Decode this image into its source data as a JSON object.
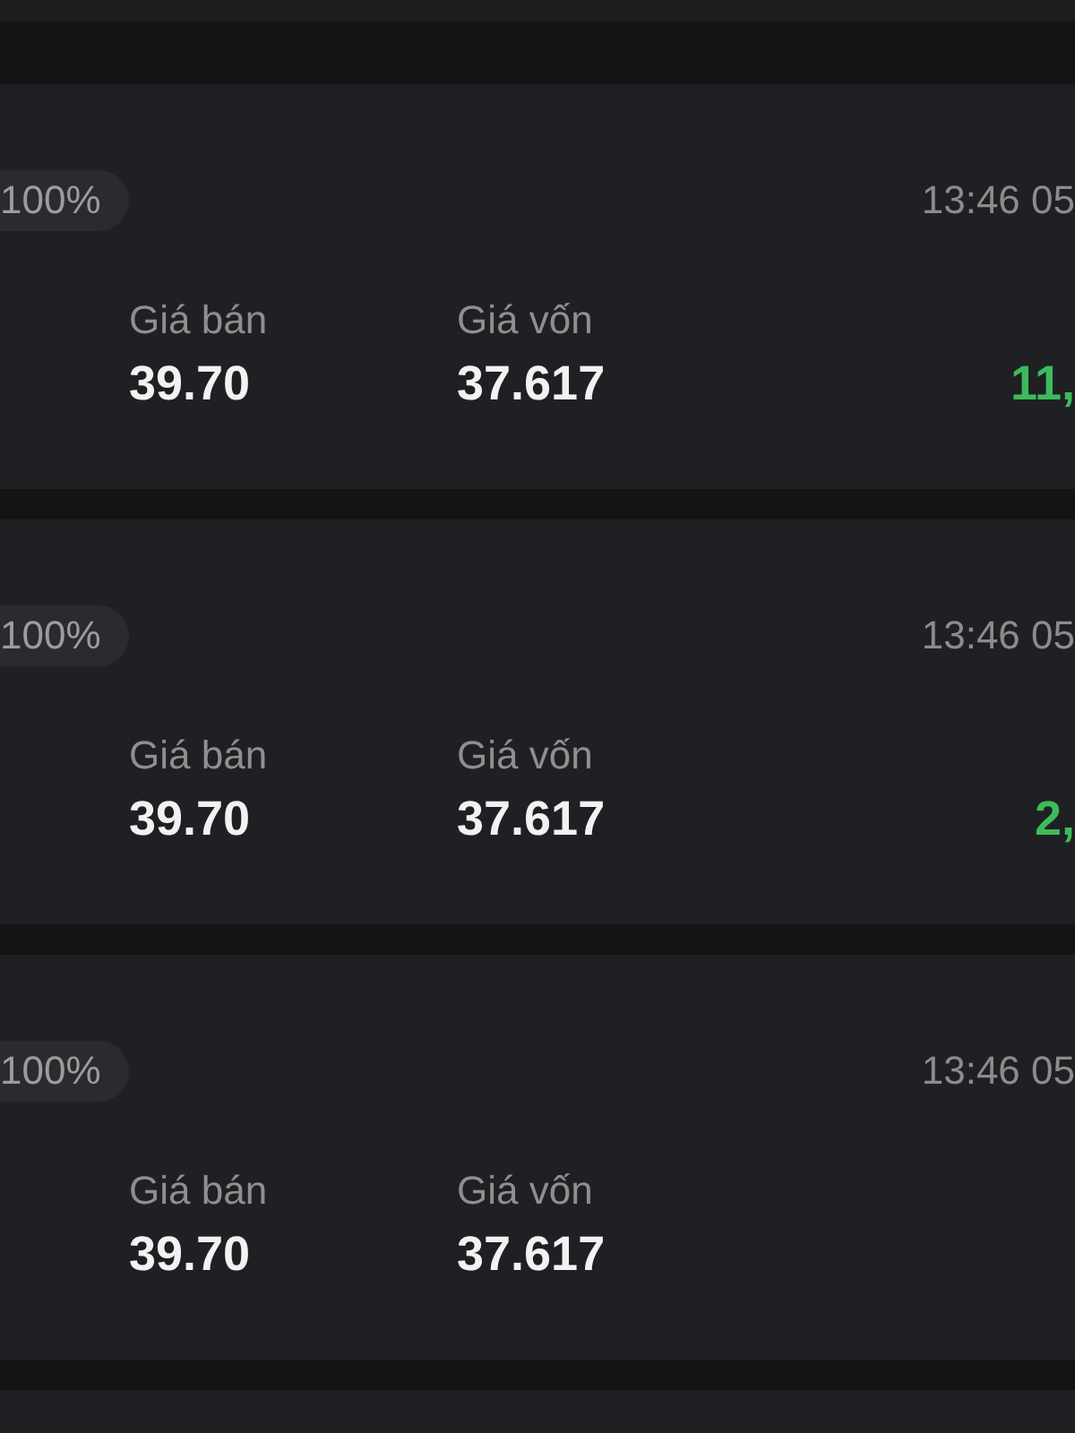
{
  "orders": [
    {
      "fill_badge": "100%",
      "time": "13:46 05",
      "fields": [
        {
          "label": "Giá bán",
          "value": "39.70"
        },
        {
          "label": "Giá vốn",
          "value": "37.617"
        }
      ],
      "profit": {
        "text": "11,",
        "color": "#3dbb5c"
      }
    },
    {
      "fill_badge": "100%",
      "time": "13:46 05",
      "fields": [
        {
          "label": "Giá bán",
          "value": "39.70"
        },
        {
          "label": "Giá vốn",
          "value": "37.617"
        }
      ],
      "profit": {
        "text": "2,",
        "color": "#3dbb5c"
      }
    },
    {
      "fill_badge": "100%",
      "time": "13:46 05",
      "fields": [
        {
          "label": "Giá bán",
          "value": "39.70"
        },
        {
          "label": "Giá vốn",
          "value": "37.617"
        }
      ]
    }
  ]
}
